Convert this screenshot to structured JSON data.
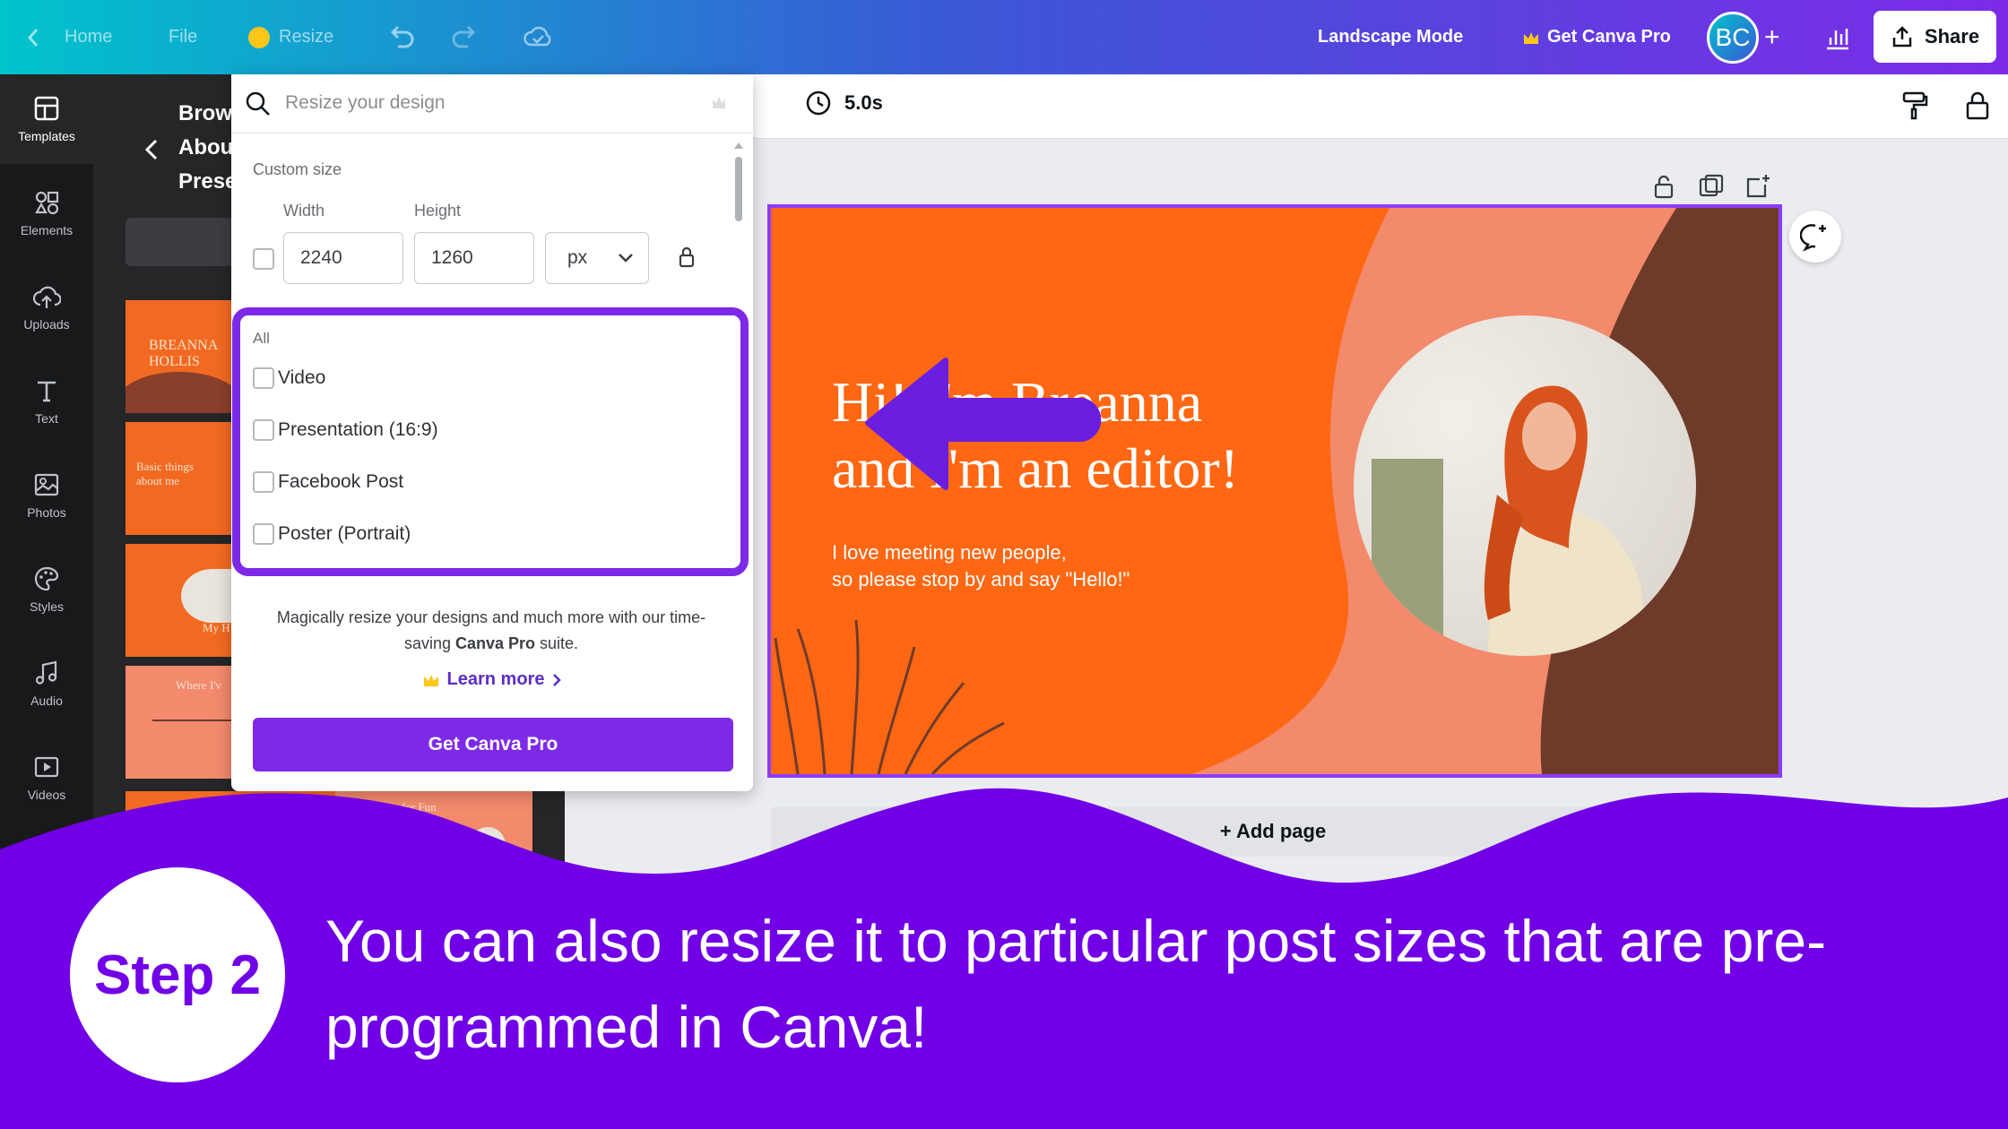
{
  "colors": {
    "brand_purple": "#7d2ae8",
    "band_purple": "#7100e6",
    "slide_orange": "#ff6713",
    "slide_brown": "#6e3b2b",
    "slide_peach": "#f28a6b"
  },
  "topbar": {
    "home": "Home",
    "file": "File",
    "resize": "Resize",
    "mode": "Landscape Mode",
    "get_pro": "Get Canva Pro",
    "avatar_initials": "BC",
    "share": "Share"
  },
  "rail": [
    {
      "label": "Templates",
      "icon": "templates-icon"
    },
    {
      "label": "Elements",
      "icon": "elements-icon"
    },
    {
      "label": "Uploads",
      "icon": "uploads-icon"
    },
    {
      "label": "Text",
      "icon": "text-icon"
    },
    {
      "label": "Photos",
      "icon": "photos-icon"
    },
    {
      "label": "Styles",
      "icon": "styles-icon"
    },
    {
      "label": "Audio",
      "icon": "audio-icon"
    },
    {
      "label": "Videos",
      "icon": "videos-icon"
    }
  ],
  "sidepanel": {
    "line1": "Brow",
    "line2": "Abou",
    "line3": "Prese",
    "thumb1": "BREANNA HOLLIS",
    "thumb2": "Basic things about me",
    "thumb3": "My H",
    "thumb4": "Where I'v",
    "thumb5": "What I Do for Fun"
  },
  "context": {
    "duration": "5.0s"
  },
  "popup": {
    "search_placeholder": "Resize your design",
    "custom_size": "Custom size",
    "width_label": "Width",
    "height_label": "Height",
    "width_value": "2240",
    "height_value": "1260",
    "unit": "px",
    "all_label": "All",
    "options": [
      "Video",
      "Presentation (16:9)",
      "Facebook Post",
      "Poster (Portrait)"
    ],
    "promo_a": "Magically resize your designs and much more with our time-saving ",
    "promo_b": "Canva Pro",
    "promo_c": " suite.",
    "learn_more": "Learn more",
    "cta": "Get Canva Pro"
  },
  "slide": {
    "title_a": "Hi! I'm Breanna",
    "title_b": "and I'm an editor!",
    "body_a": "I love meeting new people,",
    "body_b": "so please stop by and say \"Hello!\""
  },
  "add_page": "+ Add page",
  "caption": {
    "step": "Step 2",
    "text": "You can also resize it to particular post sizes that are pre-programmed in Canva!"
  }
}
